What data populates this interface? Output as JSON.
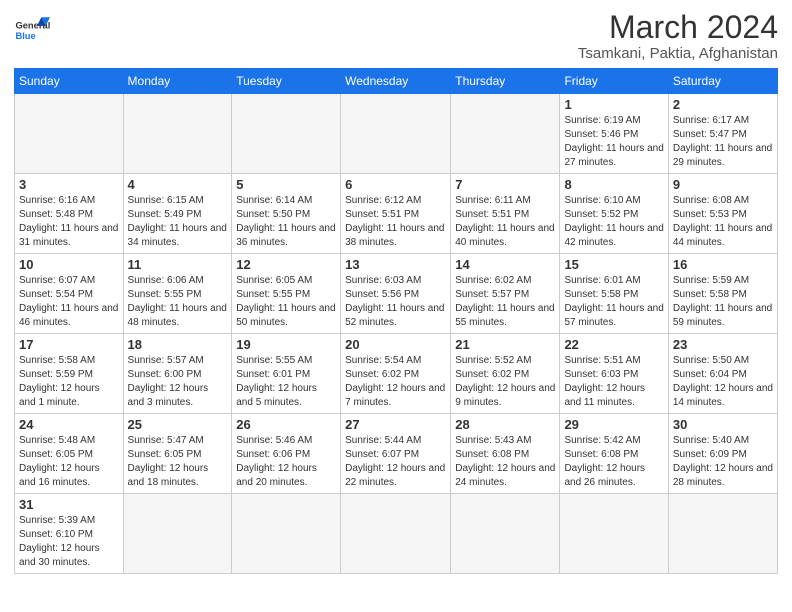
{
  "header": {
    "logo_general": "General",
    "logo_blue": "Blue",
    "month_title": "March 2024",
    "location": "Tsamkani, Paktia, Afghanistan"
  },
  "weekdays": [
    "Sunday",
    "Monday",
    "Tuesday",
    "Wednesday",
    "Thursday",
    "Friday",
    "Saturday"
  ],
  "weeks": [
    [
      {
        "day": "",
        "info": "",
        "empty": true
      },
      {
        "day": "",
        "info": "",
        "empty": true
      },
      {
        "day": "",
        "info": "",
        "empty": true
      },
      {
        "day": "",
        "info": "",
        "empty": true
      },
      {
        "day": "",
        "info": "",
        "empty": true
      },
      {
        "day": "1",
        "info": "Sunrise: 6:19 AM\nSunset: 5:46 PM\nDaylight: 11 hours and 27 minutes."
      },
      {
        "day": "2",
        "info": "Sunrise: 6:17 AM\nSunset: 5:47 PM\nDaylight: 11 hours and 29 minutes."
      }
    ],
    [
      {
        "day": "3",
        "info": "Sunrise: 6:16 AM\nSunset: 5:48 PM\nDaylight: 11 hours and 31 minutes."
      },
      {
        "day": "4",
        "info": "Sunrise: 6:15 AM\nSunset: 5:49 PM\nDaylight: 11 hours and 34 minutes."
      },
      {
        "day": "5",
        "info": "Sunrise: 6:14 AM\nSunset: 5:50 PM\nDaylight: 11 hours and 36 minutes."
      },
      {
        "day": "6",
        "info": "Sunrise: 6:12 AM\nSunset: 5:51 PM\nDaylight: 11 hours and 38 minutes."
      },
      {
        "day": "7",
        "info": "Sunrise: 6:11 AM\nSunset: 5:51 PM\nDaylight: 11 hours and 40 minutes."
      },
      {
        "day": "8",
        "info": "Sunrise: 6:10 AM\nSunset: 5:52 PM\nDaylight: 11 hours and 42 minutes."
      },
      {
        "day": "9",
        "info": "Sunrise: 6:08 AM\nSunset: 5:53 PM\nDaylight: 11 hours and 44 minutes."
      }
    ],
    [
      {
        "day": "10",
        "info": "Sunrise: 6:07 AM\nSunset: 5:54 PM\nDaylight: 11 hours and 46 minutes."
      },
      {
        "day": "11",
        "info": "Sunrise: 6:06 AM\nSunset: 5:55 PM\nDaylight: 11 hours and 48 minutes."
      },
      {
        "day": "12",
        "info": "Sunrise: 6:05 AM\nSunset: 5:55 PM\nDaylight: 11 hours and 50 minutes."
      },
      {
        "day": "13",
        "info": "Sunrise: 6:03 AM\nSunset: 5:56 PM\nDaylight: 11 hours and 52 minutes."
      },
      {
        "day": "14",
        "info": "Sunrise: 6:02 AM\nSunset: 5:57 PM\nDaylight: 11 hours and 55 minutes."
      },
      {
        "day": "15",
        "info": "Sunrise: 6:01 AM\nSunset: 5:58 PM\nDaylight: 11 hours and 57 minutes."
      },
      {
        "day": "16",
        "info": "Sunrise: 5:59 AM\nSunset: 5:58 PM\nDaylight: 11 hours and 59 minutes."
      }
    ],
    [
      {
        "day": "17",
        "info": "Sunrise: 5:58 AM\nSunset: 5:59 PM\nDaylight: 12 hours and 1 minute."
      },
      {
        "day": "18",
        "info": "Sunrise: 5:57 AM\nSunset: 6:00 PM\nDaylight: 12 hours and 3 minutes."
      },
      {
        "day": "19",
        "info": "Sunrise: 5:55 AM\nSunset: 6:01 PM\nDaylight: 12 hours and 5 minutes."
      },
      {
        "day": "20",
        "info": "Sunrise: 5:54 AM\nSunset: 6:02 PM\nDaylight: 12 hours and 7 minutes."
      },
      {
        "day": "21",
        "info": "Sunrise: 5:52 AM\nSunset: 6:02 PM\nDaylight: 12 hours and 9 minutes."
      },
      {
        "day": "22",
        "info": "Sunrise: 5:51 AM\nSunset: 6:03 PM\nDaylight: 12 hours and 11 minutes."
      },
      {
        "day": "23",
        "info": "Sunrise: 5:50 AM\nSunset: 6:04 PM\nDaylight: 12 hours and 14 minutes."
      }
    ],
    [
      {
        "day": "24",
        "info": "Sunrise: 5:48 AM\nSunset: 6:05 PM\nDaylight: 12 hours and 16 minutes."
      },
      {
        "day": "25",
        "info": "Sunrise: 5:47 AM\nSunset: 6:05 PM\nDaylight: 12 hours and 18 minutes."
      },
      {
        "day": "26",
        "info": "Sunrise: 5:46 AM\nSunset: 6:06 PM\nDaylight: 12 hours and 20 minutes."
      },
      {
        "day": "27",
        "info": "Sunrise: 5:44 AM\nSunset: 6:07 PM\nDaylight: 12 hours and 22 minutes."
      },
      {
        "day": "28",
        "info": "Sunrise: 5:43 AM\nSunset: 6:08 PM\nDaylight: 12 hours and 24 minutes."
      },
      {
        "day": "29",
        "info": "Sunrise: 5:42 AM\nSunset: 6:08 PM\nDaylight: 12 hours and 26 minutes."
      },
      {
        "day": "30",
        "info": "Sunrise: 5:40 AM\nSunset: 6:09 PM\nDaylight: 12 hours and 28 minutes."
      }
    ],
    [
      {
        "day": "31",
        "info": "Sunrise: 5:39 AM\nSunset: 6:10 PM\nDaylight: 12 hours and 30 minutes."
      },
      {
        "day": "",
        "info": "",
        "empty": true
      },
      {
        "day": "",
        "info": "",
        "empty": true
      },
      {
        "day": "",
        "info": "",
        "empty": true
      },
      {
        "day": "",
        "info": "",
        "empty": true
      },
      {
        "day": "",
        "info": "",
        "empty": true
      },
      {
        "day": "",
        "info": "",
        "empty": true
      }
    ]
  ]
}
